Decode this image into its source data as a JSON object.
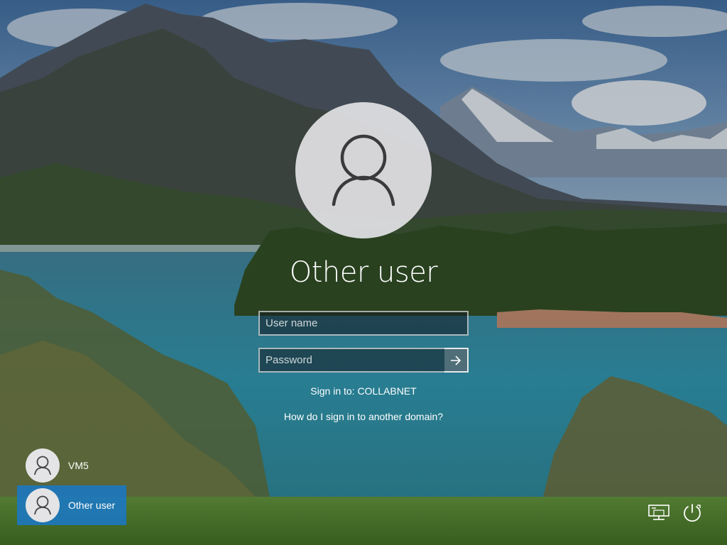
{
  "login": {
    "user_display_name": "Other user",
    "username_placeholder": "User name",
    "password_placeholder": "Password",
    "sign_in_to": "Sign in to: COLLABNET",
    "domain_help_link": "How do I sign in to another domain?"
  },
  "user_list": [
    {
      "label": "VM5",
      "selected": false
    },
    {
      "label": "Other user",
      "selected": true
    }
  ],
  "system_icons": [
    "network-icon",
    "power-icon"
  ],
  "colors": {
    "selected_tile": "#1a78c4",
    "field_border": "#ffffff",
    "text": "#ffffff"
  }
}
